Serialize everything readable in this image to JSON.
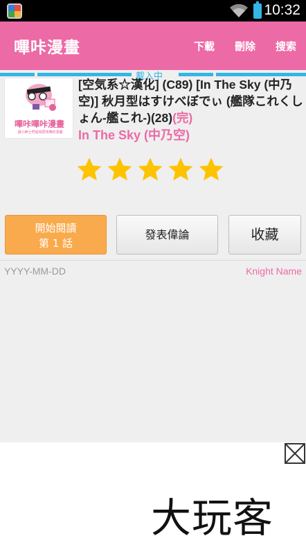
{
  "status_bar": {
    "time": "10:32",
    "icons": [
      "app-icon",
      "wifi-icon",
      "battery-icon"
    ]
  },
  "action_bar": {
    "title": "嗶咔漫畫",
    "actions": {
      "download": "下載",
      "delete": "刪除",
      "search": "搜索"
    }
  },
  "loading": {
    "label": "載入中"
  },
  "cover": {
    "title": "嗶咔嗶咔漫畫",
    "subtitle": "讓小紳士們過得更快樂的漫畫"
  },
  "comic": {
    "title": "[空気系☆漢化] (C89) [In The Sky (中乃空)] 秋月型はすけべぼでぃ (艦隊これくしょん-艦これ-)(28)",
    "status": "(完)",
    "author": "In The Sky (中乃空)",
    "rating": 5
  },
  "buttons": {
    "read_line1": "開始閱讀",
    "read_line2": "第 1 話",
    "comment": "發表偉論",
    "favorite": "收藏"
  },
  "comment_row": {
    "date": "YYYY-MM-DD",
    "name": "Knight Name"
  },
  "ad": {
    "text": "大玩客",
    "close_icon": "close-icon"
  },
  "colors": {
    "accent": "#ec6aa6",
    "read_button": "#f9aa4c",
    "star": "#fdc300",
    "loading": "#33b5e5"
  }
}
